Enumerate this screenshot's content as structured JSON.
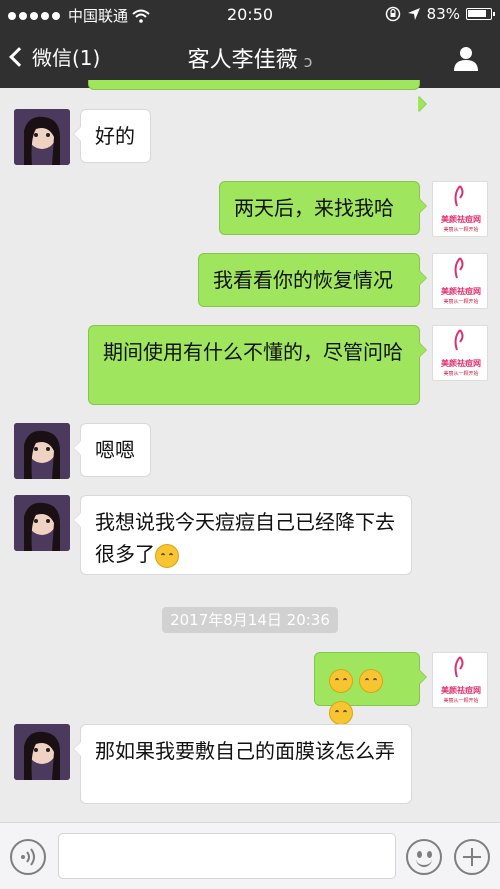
{
  "status_bar": {
    "carrier": "中国联通",
    "time": "20:50",
    "battery": "83%"
  },
  "nav": {
    "back_label": "微信(1)",
    "title": "客人李佳薇"
  },
  "merchant_logo": {
    "name": "美颜祛痘网",
    "tagline": "美丽从一颗开始"
  },
  "messages": [
    {
      "side": "in",
      "text": "好的"
    },
    {
      "side": "out",
      "text": "两天后，来找我哈"
    },
    {
      "side": "out",
      "text": "我看看你的恢复情况"
    },
    {
      "side": "out",
      "text": "期间使用有什么不懂的，尽管问哈"
    },
    {
      "side": "in",
      "text": "嗯嗯"
    },
    {
      "side": "in",
      "text": "我想说我今天痘痘自己已经降下去很多了"
    },
    {
      "side": "out",
      "text": ""
    },
    {
      "side": "in",
      "text": "那如果我要敷自己的面膜该怎么弄"
    }
  ],
  "timestamp": "2017年8月14日 20:36",
  "colors": {
    "nav_bg": "#303030",
    "chat_bg": "#ebebeb",
    "bubble_out": "#9fe65e",
    "bubble_in": "#ffffff",
    "logo_accent": "#e0316f"
  },
  "icons": [
    "signal-dots-icon",
    "wifi-icon",
    "lock-rotation-icon",
    "location-arrow-icon",
    "battery-icon",
    "back-chevron-icon",
    "ear-icon",
    "person-icon",
    "voice-icon",
    "emoji-icon",
    "plus-icon"
  ]
}
